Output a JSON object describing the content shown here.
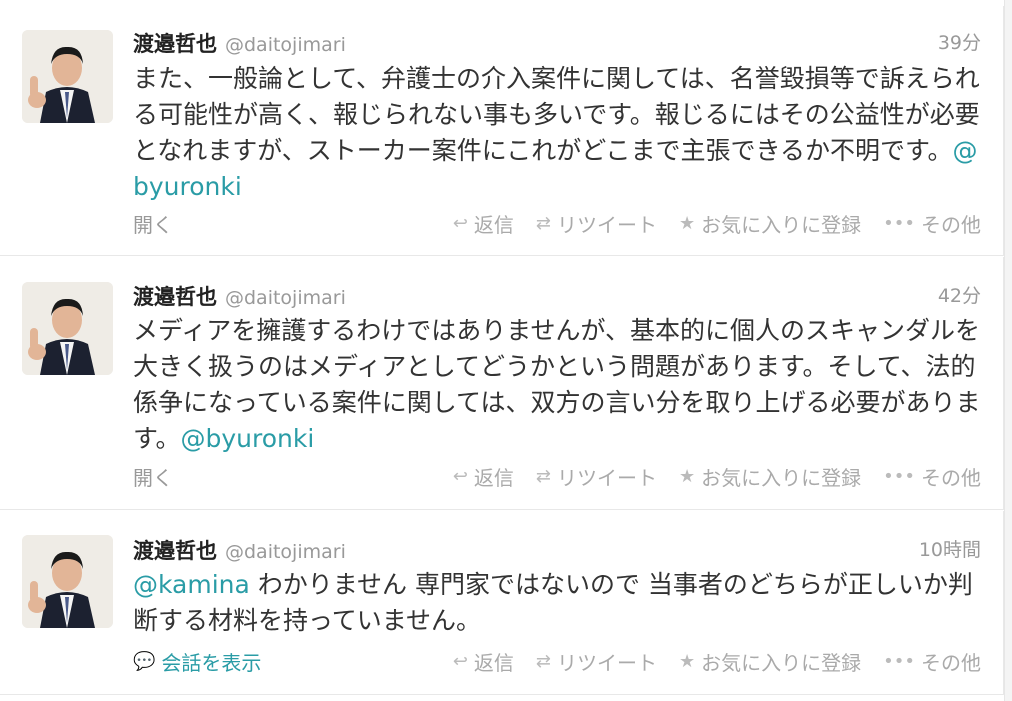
{
  "tweets": [
    {
      "name": "渡邉哲也",
      "handle": "@daitojimari",
      "time": "39分",
      "text": "また、一般論として、弁護士の介入案件に関しては、名誉毀損等で訴えられる可能性が高く、報じられない事も多いです。報じるにはその公益性が必要となれますが、ストーカー案件にこれがどこまで主張できるか不明です。",
      "mention": "@byuronki",
      "footer_link": "開く"
    },
    {
      "name": "渡邉哲也",
      "handle": "@daitojimari",
      "time": "42分",
      "text": "メディアを擁護するわけではありませんが、基本的に個人のスキャンダルを大きく扱うのはメディアとしてどうかという問題があります。そして、法的係争になっている案件に関しては、双方の言い分を取り上げる必要があります。",
      "mention": "@byuronki",
      "footer_link": "開く"
    },
    {
      "name": "渡邉哲也",
      "handle": "@daitojimari",
      "time": "10時間",
      "mention_prefix": "@kamina",
      "text": " わかりません 専門家ではないので 当事者のどちらが正しいか判断する材料を持っていません。",
      "footer_link": "会話を表示"
    }
  ],
  "actions": {
    "reply": "返信",
    "retweet": "リツイート",
    "favorite": "お気に入りに登録",
    "more": "その他"
  },
  "icons": {
    "reply": "reply-arrow-icon",
    "retweet": "retweet-icon",
    "favorite": "star-icon",
    "more": "dots-icon",
    "conversation": "speech-bubble-icon"
  },
  "colors": {
    "mention": "#2a9ca6",
    "muted": "#999999"
  }
}
